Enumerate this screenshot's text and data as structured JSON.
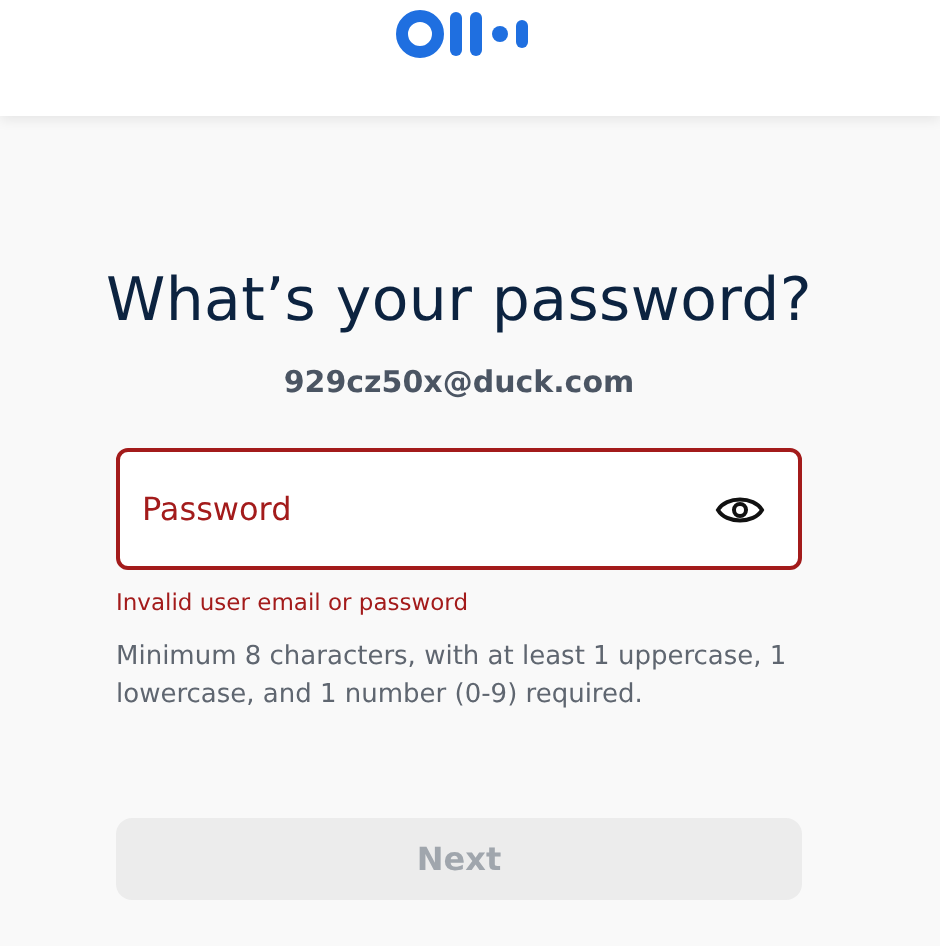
{
  "title": "What’s your password?",
  "email": "929cz50x@duck.com",
  "password_field": {
    "placeholder": "Password",
    "invalid": true
  },
  "error_message": "Invalid user email or password",
  "hint": "Minimum 8 characters, with at least 1 uppercase, 1 lowercase, and 1 number (0-9) required.",
  "next_button": {
    "label": "Next",
    "disabled": true
  }
}
